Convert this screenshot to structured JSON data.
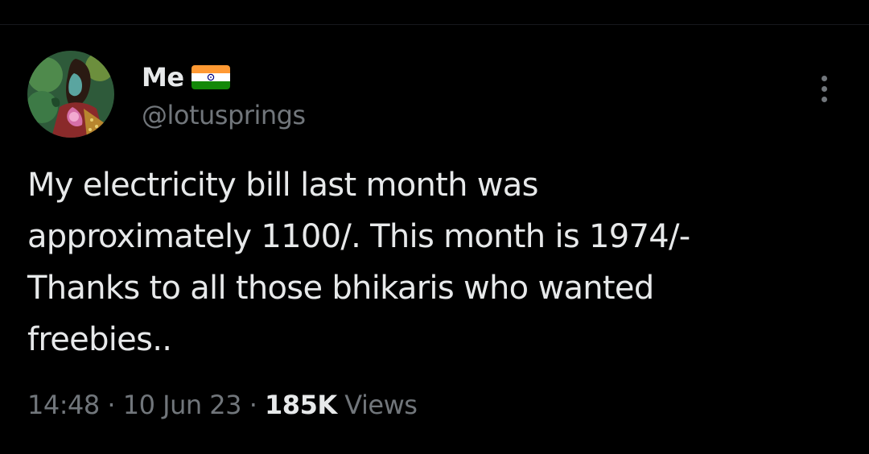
{
  "author": {
    "display_name": "Me",
    "flag_icon": "india-flag-icon",
    "handle": "@lotusprings"
  },
  "tweet": {
    "lines": [
      "My electricity bill last month was",
      "approximately 1100/. This month is 1974/-",
      "Thanks to all those bhikaris who wanted",
      "freebies.."
    ]
  },
  "meta": {
    "time": "14:48",
    "separator": "·",
    "date": "10 Jun 23",
    "views_count": "185K",
    "views_label": "Views"
  },
  "icons": {
    "more": "more-options-icon"
  },
  "colors": {
    "background": "#000000",
    "primary_text": "#e7e9ea",
    "secondary_text": "#71767b",
    "flag_saffron": "#ff9933",
    "flag_white": "#ffffff",
    "flag_green": "#138808",
    "flag_chakra": "#000080"
  }
}
